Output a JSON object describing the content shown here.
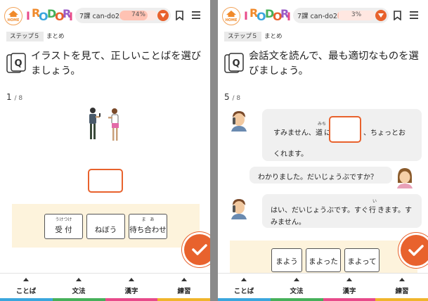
{
  "header": {
    "home_label": "HOME",
    "logo_letters": [
      "I",
      "R",
      "O",
      "D",
      "O",
      "R",
      "I"
    ],
    "logo_colors": [
      "#e84a8a",
      "#f08a2b",
      "#3aa6dd",
      "#46b05a",
      "#e8622d",
      "#9a5bc6",
      "#e84a8a"
    ],
    "bookmark_icon": "bookmark-icon",
    "menu_icon": "hamburger-menu-icon"
  },
  "screens": [
    {
      "course_lesson": "7課 can-do23",
      "progress_pct": 74,
      "progress_text": "74%",
      "step_label": "ステップ５",
      "step_sub": "まとめ",
      "question": "イラストを見て、正しいことばを選びましょう。",
      "counter_current": "1",
      "counter_total": "/ 8",
      "choices": [
        {
          "ruby": "うけつけ",
          "label": "受 付"
        },
        {
          "ruby": "",
          "label": "ねぼう"
        },
        {
          "ruby": "ま　あ",
          "label": "待ち合わせ"
        }
      ]
    },
    {
      "course_lesson": "7課 can-do23",
      "progress_pct": 3,
      "progress_text": "3%",
      "step_label": "ステップ５",
      "step_sub": "まとめ",
      "question": "会話文を読んで、最も適切なものを選びましょう。",
      "counter_current": "5",
      "counter_total": "/ 8",
      "dialog": {
        "line1_a": "すみません、",
        "line1_ruby": "みち",
        "line1_kanji": "道",
        "line1_b": "に",
        "line1_c": "、ちょっとお",
        "line1_d": "くれます。",
        "line2": "わかりました。だいじょうぶですか？",
        "line3_a": "はい、だいじょうぶです。すぐ",
        "line3_ruby": "い",
        "line3_kanji": "行",
        "line3_b": "きます。す",
        "line3_c": "みません。"
      },
      "choices": [
        {
          "ruby": "",
          "label": "まよう"
        },
        {
          "ruby": "",
          "label": "まよった"
        },
        {
          "ruby": "",
          "label": "まよって"
        }
      ]
    }
  ],
  "tabs": [
    {
      "label": "ことば"
    },
    {
      "label": "文法"
    },
    {
      "label": "漢字"
    },
    {
      "label": "練習"
    }
  ],
  "colors": {
    "accent": "#e8622d",
    "rainbow": [
      "#3aa6dd",
      "#46b05a",
      "#e84a8a",
      "#f0b52b"
    ]
  }
}
